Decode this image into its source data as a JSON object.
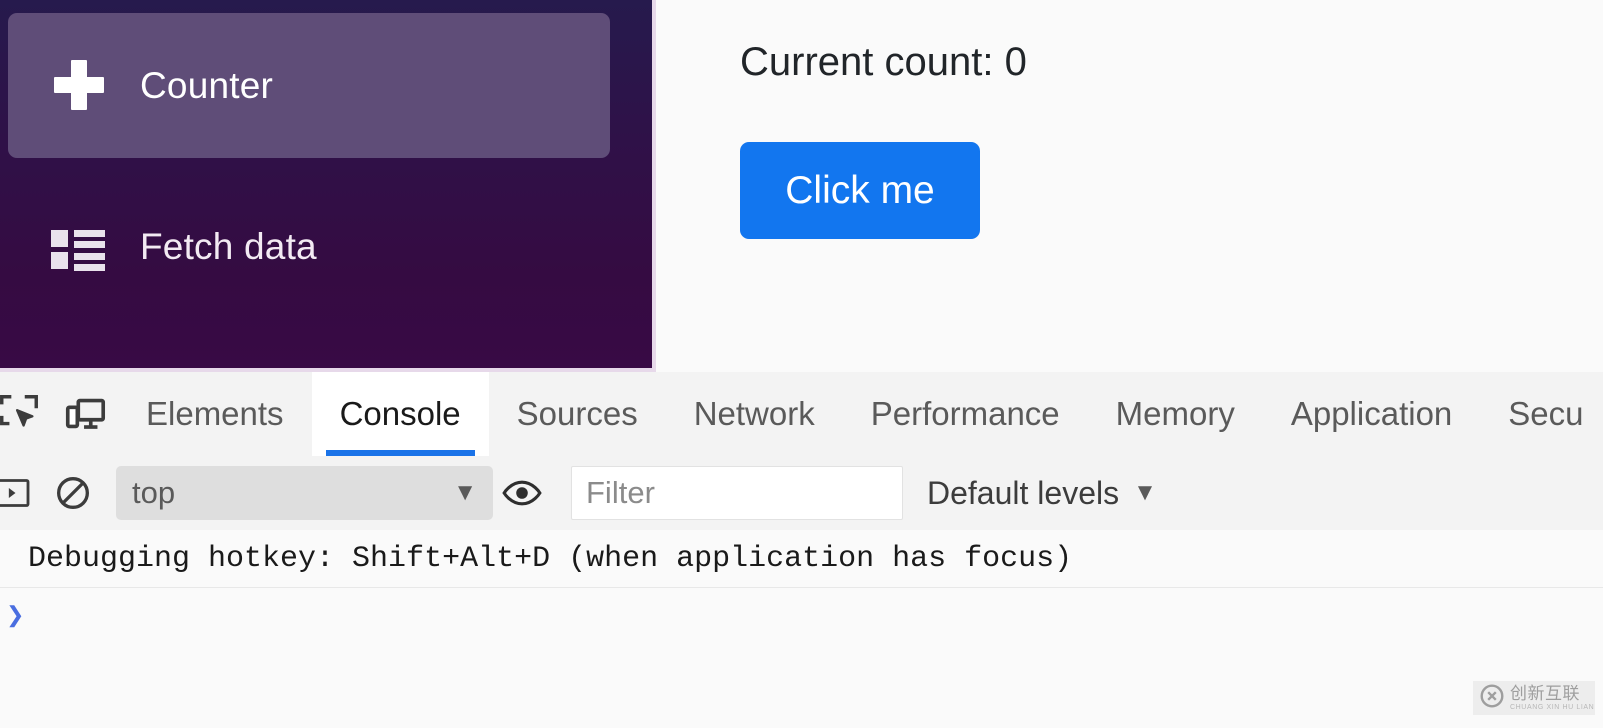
{
  "app": {
    "sidebar": {
      "items": [
        {
          "label": "Counter",
          "icon": "plus-icon",
          "active": true
        },
        {
          "label": "Fetch data",
          "icon": "list-icon",
          "active": false
        }
      ],
      "active_bg": "#5f4d78",
      "bg_gradient_from": "#261a4d",
      "bg_gradient_to": "#380a45"
    },
    "main": {
      "count_text": "Current count: 0",
      "button_label": "Click me",
      "button_color": "#1276ef"
    }
  },
  "devtools": {
    "tools": [
      {
        "name": "inspect-element-icon"
      },
      {
        "name": "device-toolbar-icon"
      }
    ],
    "tabs": [
      {
        "label": "Elements",
        "active": false
      },
      {
        "label": "Console",
        "active": true
      },
      {
        "label": "Sources",
        "active": false
      },
      {
        "label": "Network",
        "active": false
      },
      {
        "label": "Performance",
        "active": false
      },
      {
        "label": "Memory",
        "active": false
      },
      {
        "label": "Application",
        "active": false
      },
      {
        "label": "Secu",
        "active": false
      }
    ],
    "active_tab_underline": "#1a73e8",
    "console_toolbar": {
      "sidebar_toggle_icon": "console-sidebar-icon",
      "clear_icon": "clear-console-icon",
      "context_value": "top",
      "context_caret": "▼",
      "eye_icon": "live-expression-icon",
      "filter_placeholder": "Filter",
      "filter_value": "",
      "levels_label": "Default levels",
      "levels_caret": "▼"
    },
    "console_messages": [
      {
        "text": "Debugging hotkey: Shift+Alt+D (when application has focus)"
      }
    ],
    "prompt_caret": "❯"
  },
  "watermark": {
    "cn": "创新互联",
    "pinyin": "CHUANG XIN HU LIAN"
  }
}
